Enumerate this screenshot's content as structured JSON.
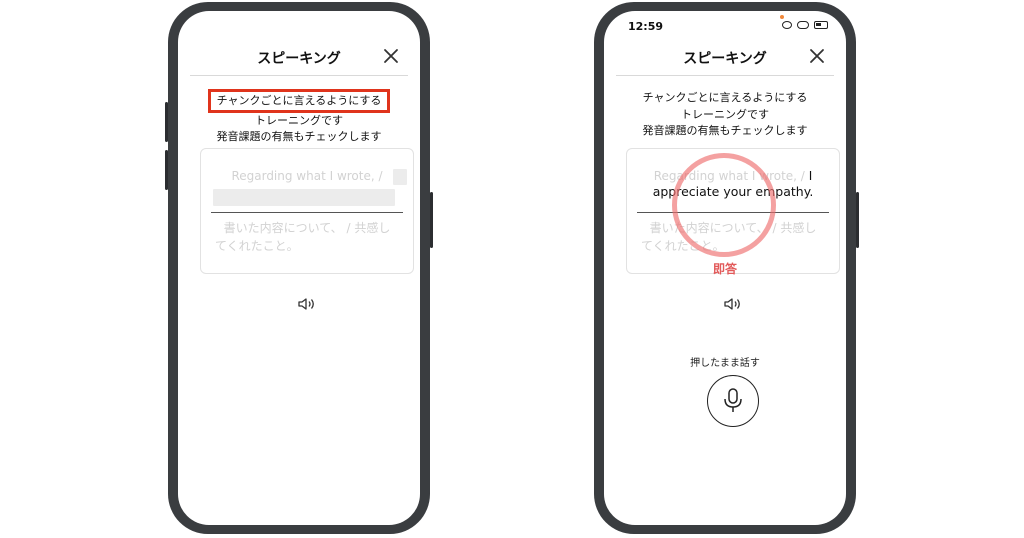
{
  "left_phone": {
    "header": {
      "title": "スピーキング"
    },
    "instructions": {
      "line1": "チャンクごとに言えるようにする",
      "line2": "トレーニングです",
      "line3": "発音課題の有無もチェックします"
    },
    "card": {
      "english": "Regarding what I wrote, /",
      "japanese_line1": "書いた内容について、 / 共感し",
      "japanese_line2": "てくれたこと。"
    },
    "highlight_color": "#e0341c"
  },
  "right_phone": {
    "status": {
      "time": "12:59"
    },
    "header": {
      "title": "スピーキング"
    },
    "instructions": {
      "line1": "チャンクごとに言えるようにする",
      "line2": "トレーニングです",
      "line3": "発音課題の有無もチェックします"
    },
    "card": {
      "english_prefix": "Regarding what I wrote, /",
      "english_answer_start": "I",
      "english_answer": "appreciate your empathy.",
      "japanese_line1": "書いた内容について、 / 共感し",
      "japanese_line2": "てくれたこと。"
    },
    "annotation": "即答",
    "hold_to_speak": "押したまま話す",
    "annotation_color": "#e25a5a"
  },
  "icons": {
    "close": "close-icon",
    "speaker": "speaker-icon",
    "microphone": "microphone-icon"
  }
}
